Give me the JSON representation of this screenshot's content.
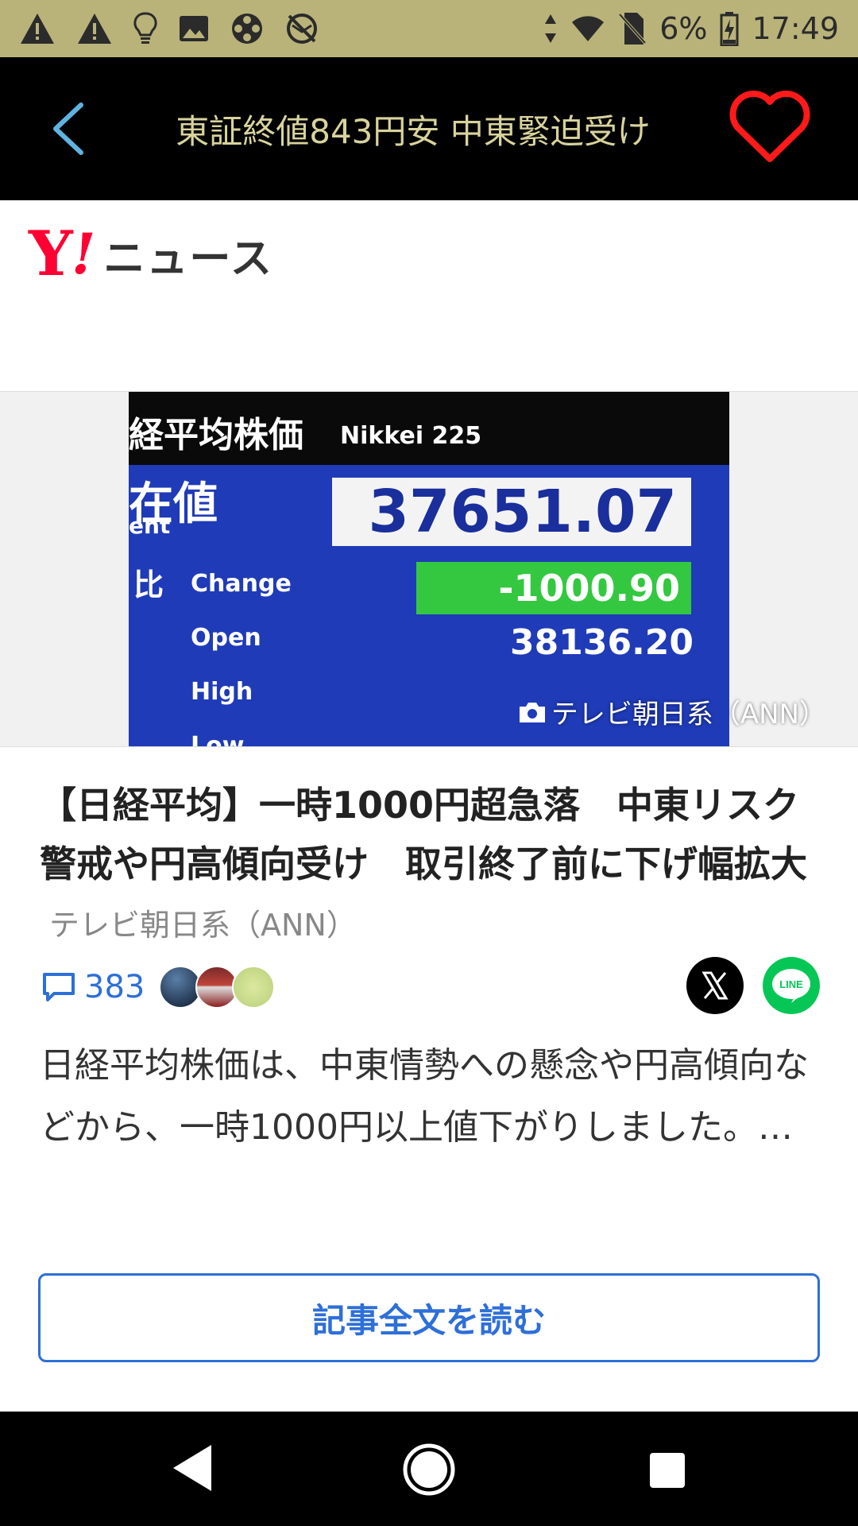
{
  "status_bar": {
    "battery": "6%",
    "time": "17:49",
    "icons": [
      "warning-icon",
      "warning-icon",
      "lightbulb-icon",
      "image-icon",
      "film-reel-icon",
      "no-sync-icon",
      "data-arrows-icon",
      "wifi-icon",
      "no-sim-icon",
      "battery-charging-icon"
    ]
  },
  "header": {
    "title": "東証終値843円安 中東緊迫受け",
    "back_icon": "chevron-left-icon",
    "favorite_icon": "heart-outline-icon",
    "favorite_color": "#ff1a1a",
    "title_color": "#d8d39c"
  },
  "brand": {
    "logo_y": "Y",
    "logo_bang": "!",
    "logo_text": "ニュース",
    "logo_color": "#ff0033"
  },
  "hero": {
    "label_index": "経平均株価",
    "label_index_en": "Nikkei 225",
    "label_current": "在値",
    "label_current_en": "ent",
    "price": "37651.07",
    "label_change_jp": "比",
    "label_change": "Change",
    "change_value": "-1000.90",
    "label_open": "Open",
    "open_value": "38136.20",
    "label_high": "High",
    "label_low": "Low",
    "credit": "テレビ朝日系（ANN）"
  },
  "article": {
    "headline": "【日経平均】一時1000円超急落　中東リスク警戒や円高傾向受け　取引終了前に下げ幅拡大",
    "source": "テレビ朝日系（ANN）",
    "comment_count": "383",
    "summary": "日経平均株価は、中東情勢への懸念や円高傾向などから、一時1000円以上値下がりしました。…",
    "read_more_label": "記事全文を読む",
    "accent_color": "#2e6fd8"
  },
  "share": {
    "x_label": "X",
    "line_label": "LINE"
  },
  "nav_bar": {
    "icons": [
      "nav-back-icon",
      "nav-home-icon",
      "nav-recents-icon"
    ]
  }
}
